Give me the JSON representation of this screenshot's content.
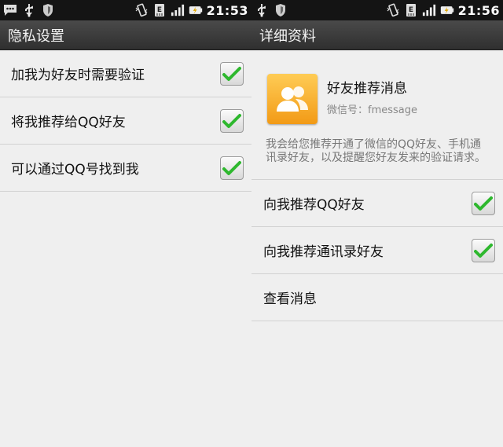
{
  "left": {
    "status": {
      "time": "21:53"
    },
    "title": "隐私设置",
    "settings": [
      {
        "label": "加我为好友时需要验证",
        "checked": true
      },
      {
        "label": "将我推荐给QQ好友",
        "checked": true
      },
      {
        "label": "可以通过QQ号找到我",
        "checked": true
      }
    ]
  },
  "right": {
    "status": {
      "time": "21:56"
    },
    "title": "详细资料",
    "profile": {
      "name": "好友推荐消息",
      "wechat_id": "微信号：fmessage"
    },
    "description": "我会给您推荐开通了微信的QQ好友、手机通讯录好友，以及提醒您好友发来的验证请求。",
    "settings": [
      {
        "label": "向我推荐QQ好友",
        "checked": true
      },
      {
        "label": "向我推荐通讯录好友",
        "checked": true
      }
    ],
    "view_messages_label": "查看消息"
  },
  "icons": [
    "chat-notification-icon",
    "usb-icon",
    "shield-icon",
    "vibrate-icon",
    "data-e-icon",
    "signal-icon",
    "battery-charging-icon",
    "checkmark-icon",
    "contacts-icon"
  ],
  "colors": {
    "status_bar": "#141414",
    "title_bar": "#3a3a3a",
    "background": "#efefef",
    "check_green": "#2eb82e",
    "avatar_orange": "#f5a623"
  }
}
